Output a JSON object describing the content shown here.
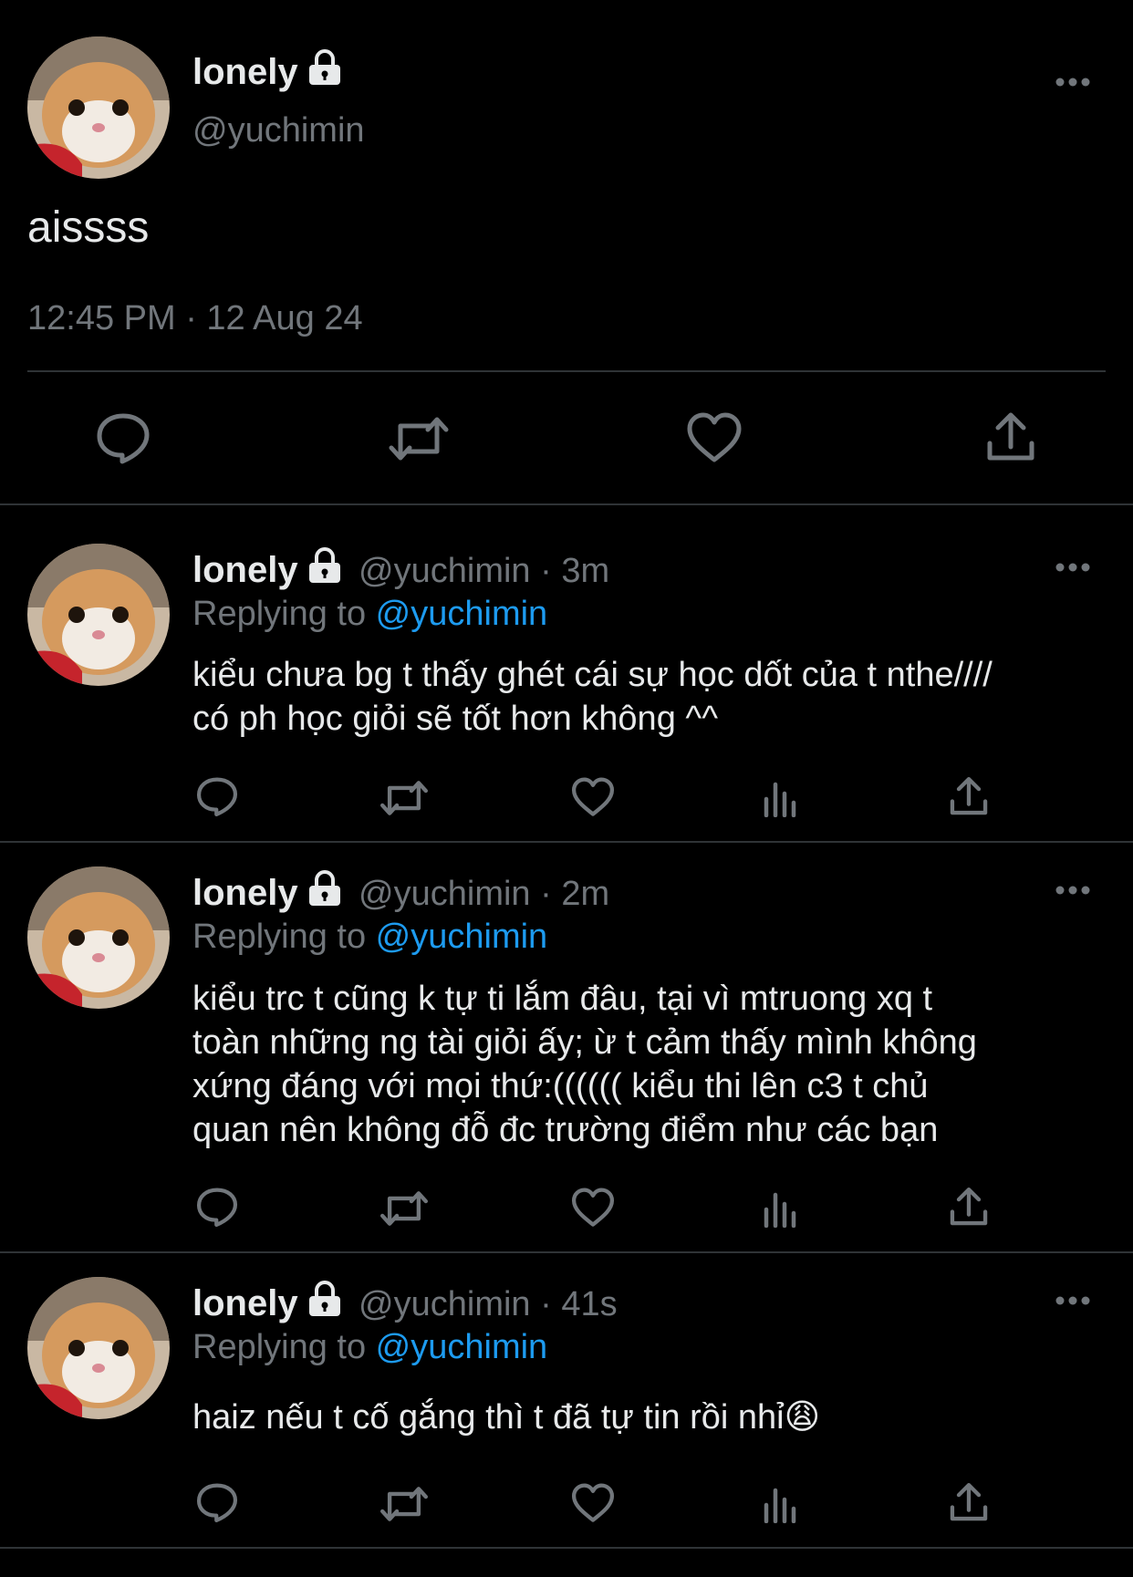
{
  "main_tweet": {
    "display_name": "lonely",
    "handle": "@yuchimin",
    "text": "aissss",
    "timestamp": "12:45 PM · 12 Aug 24"
  },
  "replies": [
    {
      "display_name": "lonely",
      "meta": "@yuchimin · 3m",
      "replying_prefix": "Replying to ",
      "replying_to": "@yuchimin",
      "lines": [
        "kiểu chưa bg t thấy ghét cái sự học dốt của t nthe////",
        "có ph học giỏi sẽ tốt hơn không ^^"
      ]
    },
    {
      "display_name": "lonely",
      "meta": "@yuchimin · 2m",
      "replying_prefix": "Replying to ",
      "replying_to": "@yuchimin",
      "lines": [
        "kiểu trc t cũng k tự ti lắm đâu, tại vì mtruong xq t",
        "toàn những ng tài giỏi ấy; ừ t cảm thấy mình không",
        "xứng đáng với mọi thứ:(((((( kiểu thi lên c3 t chủ",
        "quan nên không đỗ đc trường điểm như các bạn"
      ]
    },
    {
      "display_name": "lonely",
      "meta": "@yuchimin · 41s",
      "replying_prefix": "Replying to ",
      "replying_to": "@yuchimin",
      "lines": [
        "haiz nếu t cố gắng thì t đã tự tin rồi nhỉ😩"
      ]
    }
  ],
  "icons": [
    "lock-icon",
    "more-icon",
    "reply-icon",
    "retweet-icon",
    "like-icon",
    "views-icon",
    "share-icon"
  ],
  "colors": {
    "background": "#000000",
    "text": "#e7e9ea",
    "muted": "#71767b",
    "link": "#1d9bf0",
    "divider": "#2f3336"
  }
}
